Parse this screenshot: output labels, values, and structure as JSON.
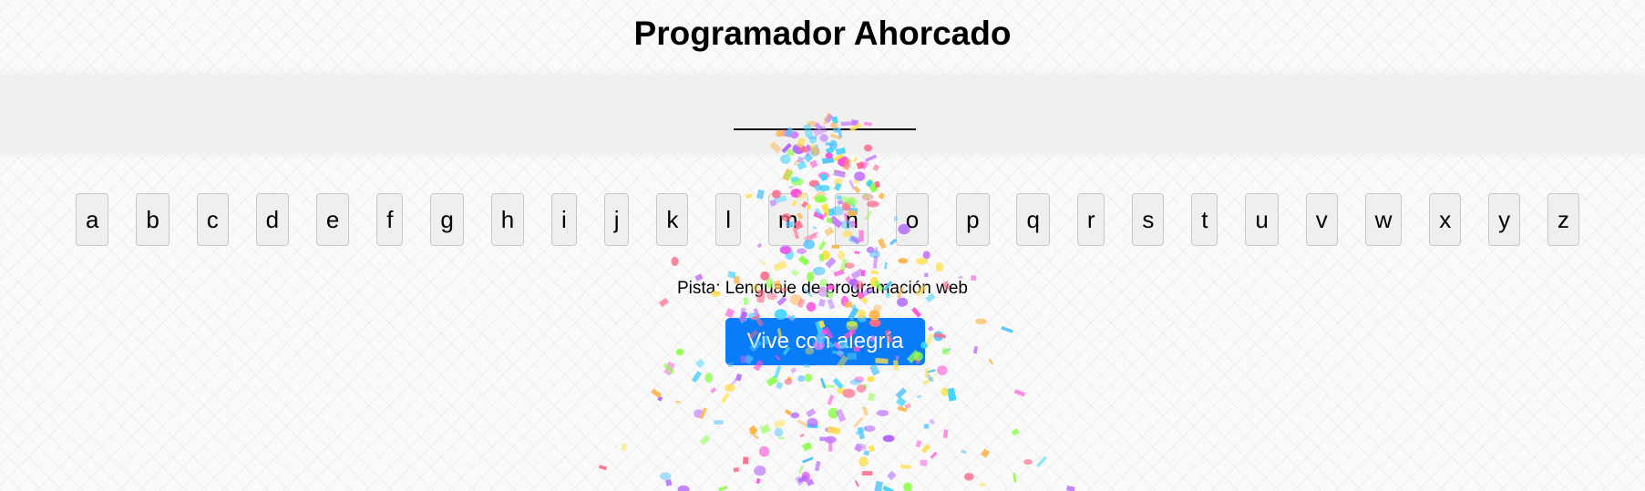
{
  "header": {
    "title": "Programador Ahorcado"
  },
  "keyboard": {
    "letters": [
      "a",
      "b",
      "c",
      "d",
      "e",
      "f",
      "g",
      "h",
      "i",
      "j",
      "k",
      "l",
      "m",
      "n",
      "o",
      "p",
      "q",
      "r",
      "s",
      "t",
      "u",
      "v",
      "w",
      "x",
      "y",
      "z"
    ]
  },
  "hint": {
    "text": "Pista: Lenguaje de programación web"
  },
  "action": {
    "label": "Vive con alegría"
  },
  "confetti": {
    "colors": [
      "#ff4fd8",
      "#4fc3ff",
      "#8fff4f",
      "#ffb347",
      "#b266ff",
      "#ff6b8a",
      "#ffe14f",
      "#3fd4ff",
      "#c77dff"
    ]
  }
}
